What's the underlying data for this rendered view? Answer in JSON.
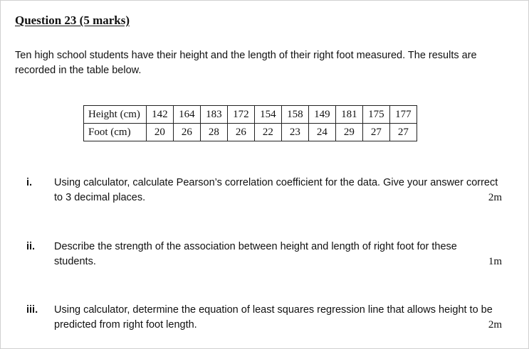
{
  "question": {
    "title": "Question 23 (5 marks)",
    "intro": "Ten high school students have their height and the length of their right foot measured. The results are recorded in the table below."
  },
  "table": {
    "rows": [
      {
        "label": "Height (cm)",
        "values": [
          "142",
          "164",
          "183",
          "172",
          "154",
          "158",
          "149",
          "181",
          "175",
          "177"
        ]
      },
      {
        "label": "Foot (cm)",
        "values": [
          "20",
          "26",
          "28",
          "26",
          "22",
          "23",
          "24",
          "29",
          "27",
          "27"
        ]
      }
    ]
  },
  "parts": [
    {
      "numeral": "i.",
      "text": "Using calculator, calculate Pearson’s correlation coefficient for the data. Give your answer correct to 3 decimal places.",
      "marks": "2m"
    },
    {
      "numeral": "ii.",
      "text": "Describe the strength of the association between height and length of right foot for these students.",
      "marks": "1m"
    },
    {
      "numeral": "iii.",
      "text": "Using calculator, determine the equation of least squares regression line that allows height to be predicted from right foot length.",
      "marks": "2m"
    }
  ]
}
